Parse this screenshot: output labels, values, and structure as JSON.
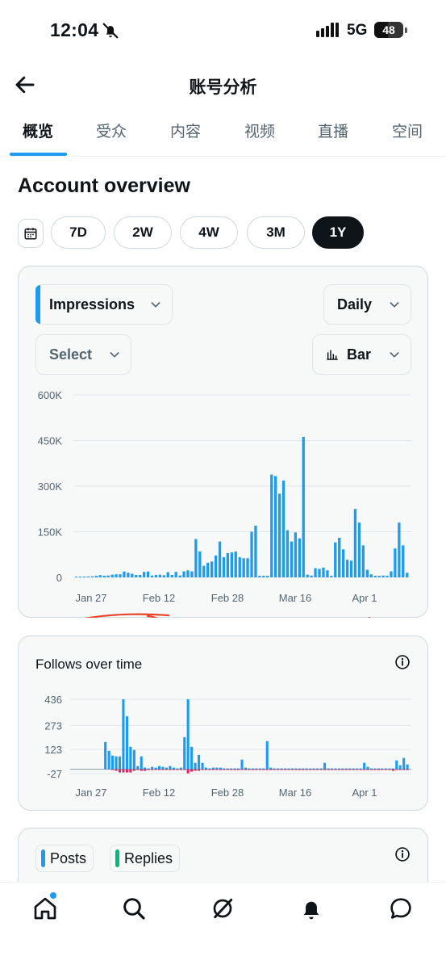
{
  "status": {
    "time": "12:04",
    "network": "5G",
    "battery": "48",
    "battery_level": 0.48
  },
  "header": {
    "title": "账号分析"
  },
  "tabs": [
    {
      "label": "概览",
      "active": true
    },
    {
      "label": "受众"
    },
    {
      "label": "内容"
    },
    {
      "label": "视频"
    },
    {
      "label": "直播"
    },
    {
      "label": "空间"
    }
  ],
  "section_title": "Account overview",
  "ranges": [
    "7D",
    "2W",
    "4W",
    "3M",
    "1Y"
  ],
  "active_range": "1Y",
  "controls": {
    "metric": "Impressions",
    "interval": "Daily",
    "compare": "Select",
    "chart_type": "Bar"
  },
  "colors": {
    "accent": "#1d9bf0",
    "negative": "#e0245e",
    "positive_green": "#00ba7c",
    "annotation": "#e8452c"
  },
  "chart_data": [
    {
      "type": "bar",
      "ylabels": [
        "600K",
        "450K",
        "300K",
        "150K",
        "0"
      ],
      "ylim": [
        0,
        600000
      ],
      "xlabels": [
        "Jan 27",
        "Feb 12",
        "Feb 28",
        "Mar 16",
        "Apr 1"
      ],
      "values": [
        2500,
        2500,
        2500,
        3000,
        3500,
        5000,
        7500,
        5500,
        6000,
        9000,
        10000,
        10000,
        19000,
        15000,
        12000,
        8000,
        8000,
        18000,
        19000,
        6000,
        8000,
        9000,
        7000,
        17000,
        8000,
        18000,
        6000,
        20000,
        23000,
        20000,
        126000,
        85000,
        38000,
        48000,
        52000,
        72000,
        118000,
        66000,
        80000,
        82000,
        85000,
        66000,
        63000,
        63000,
        150000,
        170000,
        5000,
        5000,
        5000,
        338000,
        333000,
        275000,
        318000,
        155000,
        118000,
        148000,
        128000,
        462000,
        9000,
        6000,
        30000,
        28000,
        32000,
        23000,
        5000,
        115000,
        130000,
        92000,
        58000,
        55000,
        225000,
        180000,
        105000,
        25000,
        10000,
        5000,
        5000,
        6000,
        5000,
        20000,
        95000,
        180000,
        105000,
        15000
      ],
      "annotation_circles": 6
    },
    {
      "type": "bar",
      "ylabels": [
        "436",
        "273",
        "123",
        "-27"
      ],
      "ylim": [
        -27,
        436
      ],
      "xlabels": [
        "Jan 27",
        "Feb 12",
        "Feb 28",
        "Mar 16",
        "Apr 1"
      ],
      "series": [
        {
          "name": "gains",
          "values": [
            0,
            0,
            0,
            0,
            0,
            0,
            0,
            0,
            0,
            170,
            115,
            85,
            80,
            80,
            436,
            330,
            140,
            120,
            20,
            80,
            10,
            5,
            15,
            10,
            20,
            15,
            10,
            20,
            10,
            5,
            10,
            200,
            436,
            140,
            40,
            90,
            40,
            10,
            5,
            10,
            10,
            10,
            5,
            5,
            5,
            5,
            5,
            60,
            10,
            5,
            5,
            5,
            5,
            5,
            175,
            10,
            5,
            5,
            5,
            5,
            5,
            5,
            5,
            5,
            5,
            5,
            5,
            5,
            5,
            5,
            40,
            5,
            5,
            5,
            5,
            5,
            5,
            5,
            5,
            5,
            5,
            40,
            15,
            5,
            5,
            5,
            5,
            5,
            5,
            5,
            55,
            25,
            70,
            30
          ]
        },
        {
          "name": "losses",
          "values": [
            0,
            0,
            0,
            0,
            0,
            0,
            0,
            0,
            0,
            0,
            0,
            -5,
            -10,
            -20,
            -20,
            -20,
            -20,
            -10,
            -5,
            -10,
            -10,
            -5,
            -5,
            -5,
            -5,
            -5,
            -5,
            -5,
            -5,
            -5,
            -5,
            -5,
            -25,
            -15,
            -10,
            -10,
            -5,
            -5,
            -5,
            -5,
            -5,
            -5,
            -5,
            -5,
            -5,
            -5,
            -5,
            -5,
            -5,
            -5,
            -5,
            -5,
            -5,
            -5,
            -5,
            -5,
            -5,
            -5,
            -5,
            -5,
            -5,
            -5,
            -5,
            -5,
            -5,
            -5,
            -5,
            -5,
            -5,
            -5,
            -5,
            -5,
            -5,
            -5,
            -5,
            -5,
            -5,
            -5,
            -5,
            -5,
            -5,
            -5,
            -5,
            -5,
            -5,
            -5,
            -5,
            -5,
            -5,
            -10,
            -5,
            -5,
            -5,
            -5
          ]
        }
      ]
    }
  ],
  "follows_title": "Follows over time",
  "posts_legend": [
    {
      "label": "Posts",
      "color": "#1d9bf0"
    },
    {
      "label": "Replies",
      "color": "#00ba7c"
    }
  ]
}
